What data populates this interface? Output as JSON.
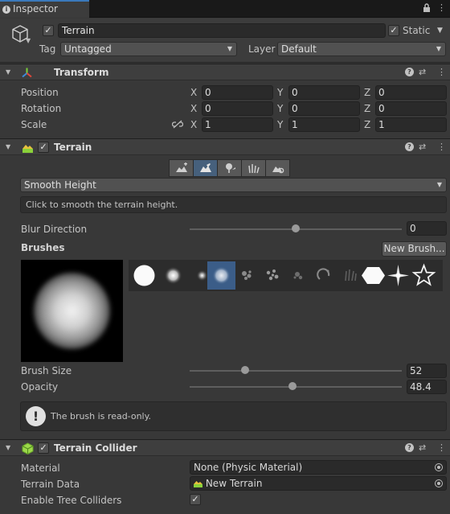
{
  "window": {
    "tab_title": "Inspector"
  },
  "gameobject": {
    "name": "Terrain",
    "static_label": "Static",
    "tag_label": "Tag",
    "tag_value": "Untagged",
    "layer_label": "Layer",
    "layer_value": "Default"
  },
  "transform": {
    "title": "Transform",
    "rows": [
      {
        "label": "Position",
        "x": "0",
        "y": "0",
        "z": "0"
      },
      {
        "label": "Rotation",
        "x": "0",
        "y": "0",
        "z": "0"
      },
      {
        "label": "Scale",
        "x": "1",
        "y": "1",
        "z": "1"
      }
    ],
    "axis_labels": [
      "X",
      "Y",
      "Z"
    ]
  },
  "terrain": {
    "title": "Terrain",
    "tool_icons": [
      "raise-lower-icon",
      "smooth-height-icon",
      "paint-texture-icon",
      "paint-details-icon",
      "terrain-settings-icon"
    ],
    "mode_value": "Smooth Height",
    "mode_help": "Click to smooth the terrain height.",
    "blur_label": "Blur Direction",
    "blur_value": "0",
    "blur_level": 0.5,
    "brushes_label": "Brushes",
    "new_brush_label": "New Brush...",
    "brush_size_label": "Brush Size",
    "brush_size_value": "52",
    "brush_size_level": 0.26,
    "opacity_label": "Opacity",
    "opacity_value": "48.4",
    "opacity_level": 0.484,
    "readonly_message": "The brush is read-only.",
    "selected_brush_index": 3
  },
  "terrain_collider": {
    "title": "Terrain Collider",
    "material_label": "Material",
    "material_value": "None (Physic Material)",
    "terrain_data_label": "Terrain Data",
    "terrain_data_value": "New Terrain",
    "tree_colliders_label": "Enable Tree Colliders",
    "tree_colliders_checked": true
  },
  "colors": {
    "accent": "#3a79bb",
    "selection": "#3b5d88",
    "background": "#383838"
  }
}
